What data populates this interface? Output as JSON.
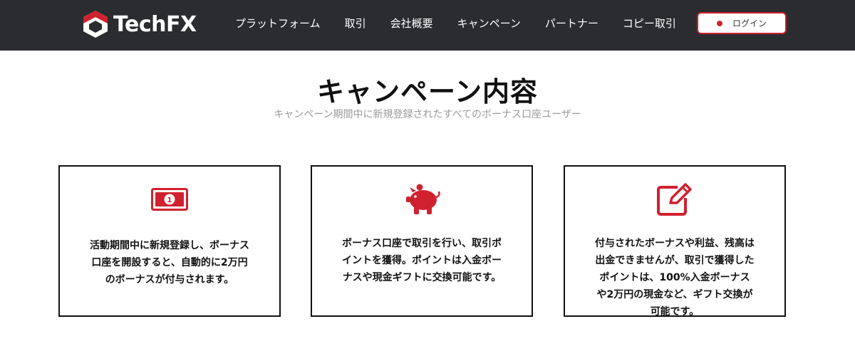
{
  "header": {
    "logo_text": "TechFX",
    "nav": [
      "プラットフォーム",
      "取引",
      "会社概要",
      "キャンペーン",
      "パートナー",
      "コピー取引"
    ],
    "login_label": "ログイン"
  },
  "campaign": {
    "title": "キャンペーン内容",
    "subtitle": "キャンペーン期間中に新規登録されたすべてのボーナス口座ユーザー"
  },
  "cards": [
    {
      "icon": "money-bill-icon",
      "text": "活動期間中に新規登録し、ボーナス口座を開設すると、自動的に2万円のボーナスが付与されます。"
    },
    {
      "icon": "piggy-bank-icon",
      "text": "ボーナス口座で取引を行い、取引ポイントを獲得。ポイントは入金ボーナスや現金ギフトに交換可能です。"
    },
    {
      "icon": "edit-icon",
      "text": "付与されたボーナスや利益、残高は出金できませんが、取引で獲得したポイントは、100%入金ボーナスや2万円の現金など、ギフト交換が可能です。"
    }
  ],
  "colors": {
    "accent": "#d0212f",
    "header_bg": "#2a2c2f"
  }
}
